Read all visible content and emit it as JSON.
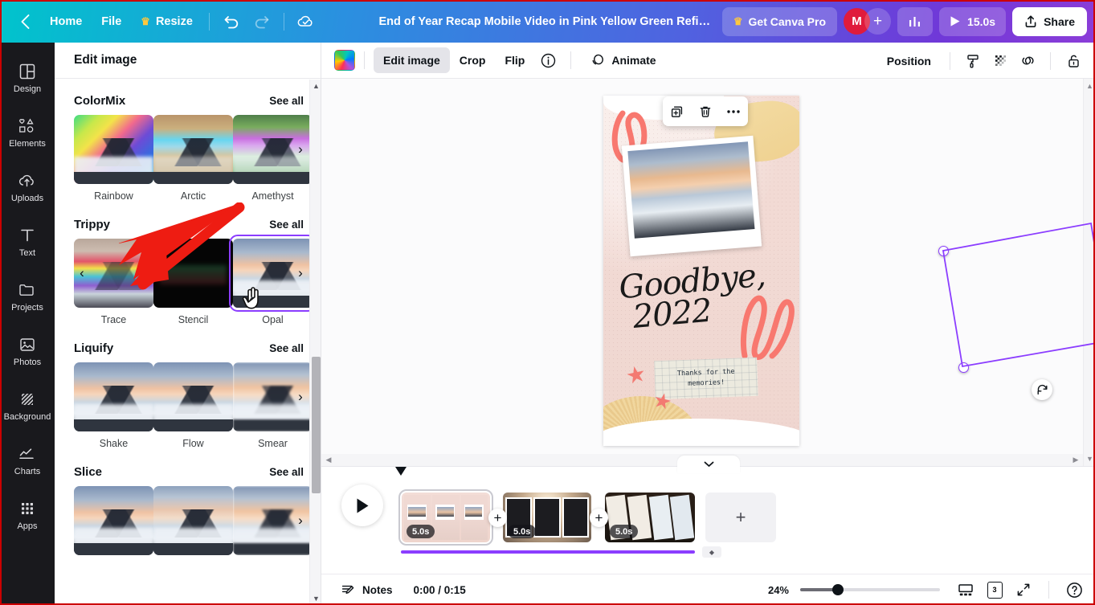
{
  "topbar": {
    "back_icon": "chevron-left-icon",
    "home_label": "Home",
    "file_label": "File",
    "resize_label": "Resize",
    "resize_badge_icon": "crown-icon",
    "undo_icon": "undo-icon",
    "redo_icon": "redo-icon",
    "cloud_icon": "cloud-saved-icon",
    "doc_title": "End of Year Recap Mobile Video in Pink Yellow Green Refine…",
    "pro_label": "Get Canva Pro",
    "avatar_initial": "M",
    "add_person_label": "+",
    "insights_icon": "bar-chart-icon",
    "preview_icon": "play-icon",
    "preview_duration": "15.0s",
    "share_icon": "share-upload-icon",
    "share_label": "Share"
  },
  "rail": {
    "items": [
      {
        "label": "Design",
        "icon": "design-layout-icon"
      },
      {
        "label": "Elements",
        "icon": "shapes-icon"
      },
      {
        "label": "Uploads",
        "icon": "cloud-upload-icon"
      },
      {
        "label": "Text",
        "icon": "text-t-icon"
      },
      {
        "label": "Projects",
        "icon": "folder-icon"
      },
      {
        "label": "Photos",
        "icon": "photo-icon"
      },
      {
        "label": "Background",
        "icon": "hatch-pattern-icon"
      },
      {
        "label": "Charts",
        "icon": "line-chart-icon"
      },
      {
        "label": "Apps",
        "icon": "apps-grid-icon"
      }
    ]
  },
  "panel": {
    "title": "Edit image",
    "see_all_label": "See all",
    "sections": [
      {
        "title": "ColorMix",
        "cards": [
          {
            "label": "Rainbow",
            "art": "sc-rainbow",
            "selected": false
          },
          {
            "label": "Arctic",
            "art": "sc-arctic",
            "selected": false
          },
          {
            "label": "Amethyst",
            "art": "sc-amethyst",
            "selected": false
          }
        ]
      },
      {
        "title": "Trippy",
        "cards": [
          {
            "label": "Trace",
            "art": "sc-trace",
            "selected": false
          },
          {
            "label": "Stencil",
            "art": "sc-stencil",
            "selected": false
          },
          {
            "label": "Opal",
            "art": "sc-opal",
            "selected": true
          }
        ]
      },
      {
        "title": "Liquify",
        "cards": [
          {
            "label": "Shake",
            "art": "sc-photo",
            "selected": false
          },
          {
            "label": "Flow",
            "art": "sc-photo",
            "selected": false
          },
          {
            "label": "Smear",
            "art": "sc-smear",
            "selected": false
          }
        ]
      },
      {
        "title": "Slice",
        "cards": [
          {
            "label": "",
            "art": "sc-photo",
            "selected": false
          },
          {
            "label": "",
            "art": "sc-slice2",
            "selected": false
          },
          {
            "label": "",
            "art": "sc-smear",
            "selected": false
          }
        ]
      }
    ]
  },
  "edtoolbar": {
    "color_swatch_icon": "color-swatch-icon",
    "edit_image_label": "Edit image",
    "crop_label": "Crop",
    "flip_label": "Flip",
    "info_icon": "info-circle-icon",
    "animate_icon": "animate-icon",
    "animate_label": "Animate",
    "position_label": "Position",
    "paint_roller_icon": "paint-roller-icon",
    "transparency_icon": "transparency-icon",
    "link_icon": "link-icon",
    "lock_icon": "lock-icon"
  },
  "canvas": {
    "design": {
      "headline_line1": "Goodbye,",
      "headline_line2": "2022",
      "note_line1": "Thanks for the",
      "note_line2": "memories!"
    },
    "context_menu": {
      "duplicate_icon": "duplicate-icon",
      "delete_icon": "trash-icon",
      "more_icon": "more-horizontal-icon"
    },
    "rotate_icon": "rotate-icon",
    "comment_icon": "add-comment-icon",
    "selection_color": "#8b3dff"
  },
  "timeline": {
    "collapse_icon": "chevron-down-icon",
    "play_icon": "play-icon",
    "add_scene_label": "+",
    "add_between_label": "+",
    "scenes": [
      {
        "duration": "5.0s",
        "selected": true
      },
      {
        "duration": "5.0s",
        "selected": false
      },
      {
        "duration": "5.0s",
        "selected": false
      }
    ]
  },
  "statusbar": {
    "notes_icon": "notes-icon",
    "notes_label": "Notes",
    "time_display": "0:00 / 0:15",
    "zoom_value": "24%",
    "presenter_icon": "presenter-view-icon",
    "page_count": "3",
    "fullscreen_icon": "expand-icon",
    "help_icon": "help-circle-icon"
  }
}
